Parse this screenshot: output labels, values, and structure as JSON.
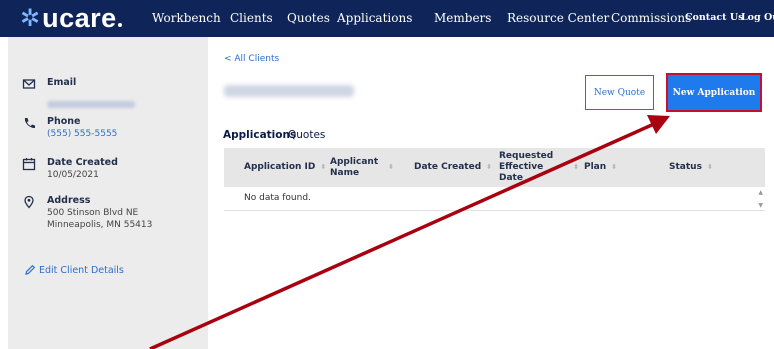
{
  "brand": {
    "logo_text": "ucare",
    "accent": "#0f2559"
  },
  "nav": {
    "workbench": "Workbench",
    "items": [
      "Clients",
      "Quotes",
      "Applications",
      "Members",
      "Resource Center",
      "Commissions"
    ],
    "contact": "Contact Us",
    "logout": "Log Out"
  },
  "sidebar": {
    "email_label": "Email",
    "phone_label": "Phone",
    "phone_value": "(555) 555-5555",
    "date_label": "Date Created",
    "date_value": "10/05/2021",
    "address_label": "Address",
    "address_line1": "500 Stinson Blvd NE",
    "address_line2": "Minneapolis, MN 55413",
    "edit_label": "Edit Client Details"
  },
  "main": {
    "back_label": "< All Clients",
    "new_quote_label": "New Quote",
    "new_application_label": "New Application",
    "tabs": [
      "Applications",
      "Quotes"
    ],
    "table": {
      "columns": [
        "Application ID",
        "Applicant Name",
        "Date Created",
        "Requested Effective Date",
        "Plan",
        "Status"
      ],
      "empty_text": "No data found."
    }
  },
  "annotation": {
    "arrow_color": "#a8000f",
    "highlight_color": "#c8102e"
  }
}
